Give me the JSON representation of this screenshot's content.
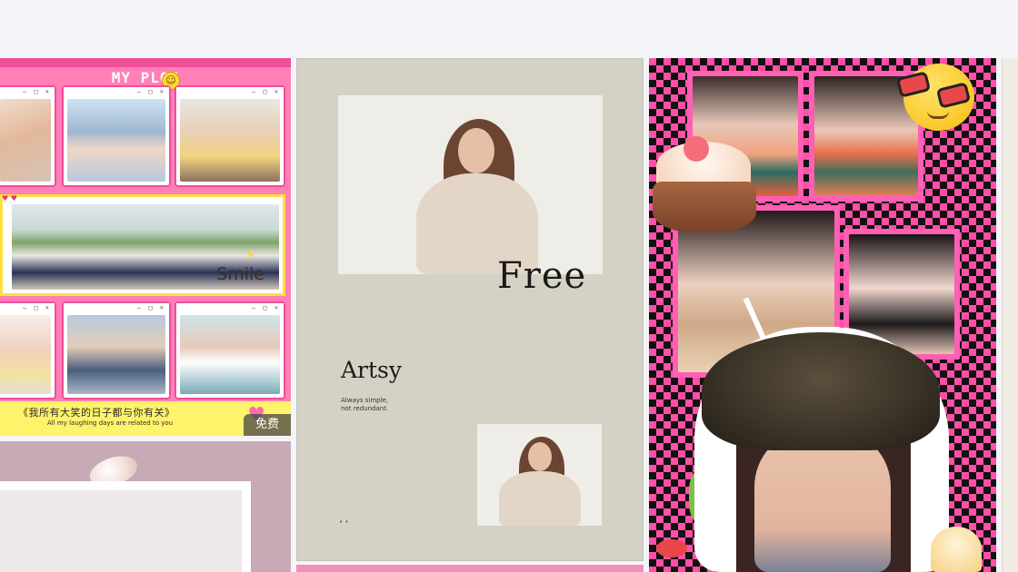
{
  "gallery": {
    "cards": [
      {
        "title": "MY PLOG",
        "smiley": "☺",
        "banner_text": "Smile",
        "caption_cn": "《我所有大笑的日子都与你有关》",
        "caption_en": "All my laughing days are related to you",
        "badge": "免费",
        "window_buttons": "– □ ×"
      },
      {
        "headline": "Free",
        "title": "Artsy",
        "subtitle_line1": "Always simple,",
        "subtitle_line2": "not redundant.",
        "dots": "• •"
      },
      {
        "sticker_emoji": "sunglasses-smiley"
      }
    ]
  },
  "colors": {
    "plog_pink": "#ff7fb6",
    "plog_yellow": "#fff36b",
    "artsy_bg": "#d4d2c4",
    "collage_pink": "#ff4fa8"
  }
}
